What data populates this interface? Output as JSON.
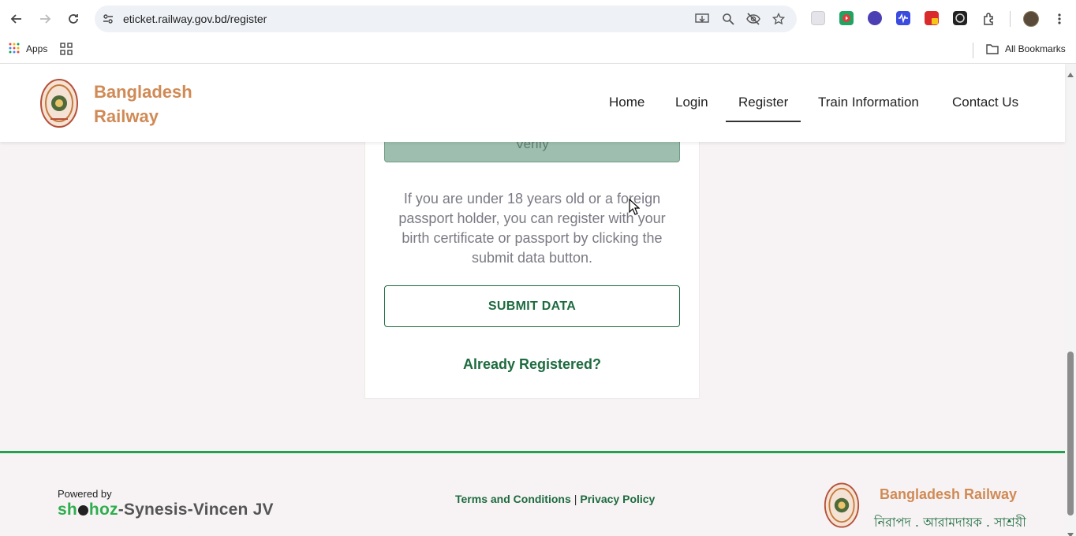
{
  "browser": {
    "url": "eticket.railway.gov.bd/register",
    "bookmarks": {
      "apps_label": "Apps",
      "all_bookmarks_label": "All Bookmarks"
    }
  },
  "header": {
    "brand_line1": "Bangladesh",
    "brand_line2": "Railway",
    "nav": [
      {
        "label": "Home"
      },
      {
        "label": "Login"
      },
      {
        "label": "Register",
        "active": true
      },
      {
        "label": "Train Information"
      },
      {
        "label": "Contact Us"
      }
    ]
  },
  "form": {
    "verify_label": "Verify",
    "info_text": "If you are under 18 years old or a foreign passport holder, you can register with your birth certificate or passport by clicking the submit data button.",
    "submit_label": "SUBMIT DATA",
    "already_registered": "Already Registered?"
  },
  "footer": {
    "powered_by": "Powered by",
    "vendor_part1": "sh",
    "vendor_part2": "hoz",
    "vendor_part3": "-Synesis-Vincen JV",
    "terms": "Terms and Conditions",
    "separator": "|",
    "privacy": "Privacy Policy",
    "brand": "Bangladesh Railway",
    "tagline": "নিরাপদ . আরামদায়ক . সাশ্রয়ী"
  },
  "colors": {
    "brand_orange": "#d08a55",
    "brand_green": "#1d6b3f",
    "footer_line": "#24a04f"
  }
}
